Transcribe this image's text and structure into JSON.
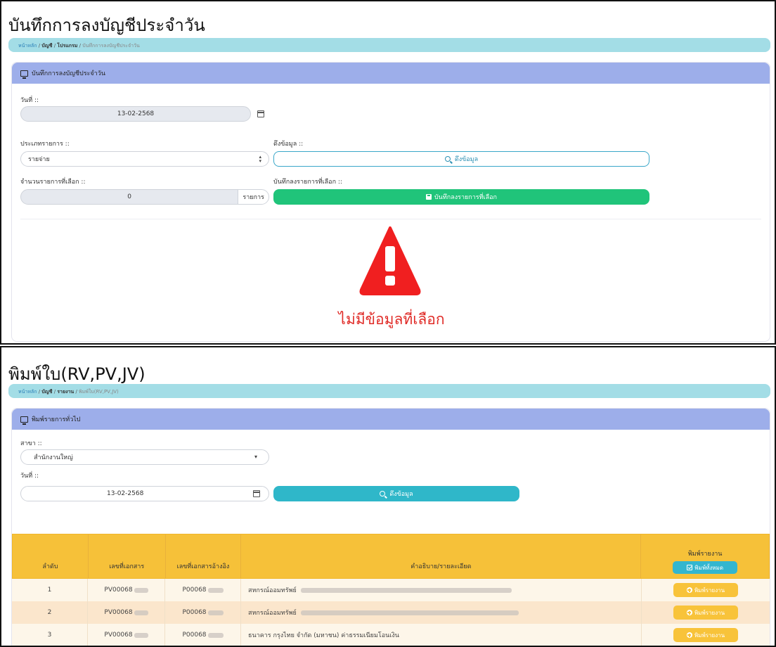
{
  "panel1": {
    "title": "บันทึกการลงบัญชีประจำวัน",
    "breadcrumb": [
      "หน้าหลัก",
      "บัญชี",
      "โปรแกรม",
      "บันทึกการลงบัญชีประจำวัน"
    ],
    "card_title": "บันทึกการลงบัญชีประจำวัน",
    "date_label": "วันที่ ::",
    "date_value": "13-02-2568",
    "type_label": "ประเภทรายการ ::",
    "type_value": "รายจ่าย",
    "fetch_label": "ดึงข้อมูล ::",
    "fetch_button": "ดึงข้อมูล",
    "count_label": "จำนวนรายการที่เลือก ::",
    "count_value": "0",
    "count_unit": "รายการ",
    "save_label": "บันทึกลงรายการที่เลือก ::",
    "save_button": "บันทึกลงรายการที่เลือก",
    "warning_icon": "exclamation-triangle-icon",
    "no_data_text": "ไม่มีข้อมูลที่เลือก"
  },
  "panel2": {
    "title": "พิมพ์ใบ(RV,PV,JV)",
    "breadcrumb": [
      "หน้าหลัก",
      "บัญชี",
      "รายงาน",
      "พิมพ์ใบ(RV,PV,JV)"
    ],
    "card_title": "พิมพ์รายการทั่วไป",
    "branch_label": "สาขา ::",
    "branch_value": "สำนักงานใหญ่",
    "date_label": "วันที่ ::",
    "date_value": "13-02-2568",
    "fetch_button": "ดึงข้อมูล",
    "table": {
      "headers": [
        "ลำดับ",
        "เลขที่เอกสาร",
        "เลขที่เอกสารอ้างอิง",
        "คำอธิบาย/รายละเอียด",
        "พิมพ์รายงาน"
      ],
      "print_all_button": "พิมพ์ทั้งหมด",
      "print_button": "พิมพ์รายงาน",
      "rows": [
        {
          "no": "1",
          "doc": "PV00068",
          "ref": "P00068",
          "desc": "สหกรณ์ออมทรัพย์"
        },
        {
          "no": "2",
          "doc": "PV00068",
          "ref": "P00068",
          "desc": "สหกรณ์ออมทรัพย์"
        },
        {
          "no": "3",
          "doc": "PV00068",
          "ref": "P00068",
          "desc": "ธนาคาร กรุงไทย จำกัด (มหาชน) ค่าธรรมเนียมโอนเงิน"
        }
      ]
    }
  },
  "colors": {
    "header_blue": "#9daeea",
    "breadcrumb": "#a3dde6",
    "green": "#20c47a",
    "teal": "#2fb7c9",
    "table_header": "#f6c139",
    "error_red": "#e02b27"
  }
}
